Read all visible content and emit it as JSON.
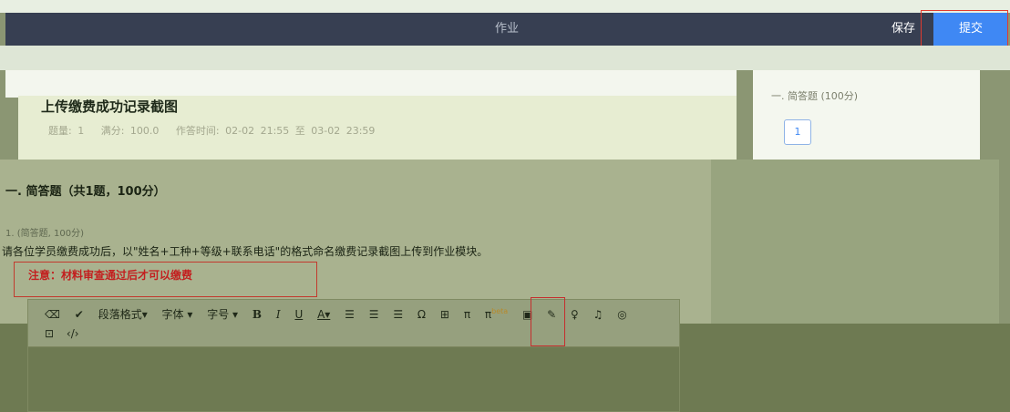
{
  "header": {
    "title": "作业",
    "save_label": "保存",
    "submit_label": "提交"
  },
  "homework": {
    "title": "上传缴费成功记录截图",
    "meta": {
      "count": "题量: 1",
      "full_score": "满分: 100.0",
      "time_label": "作答时间: 02-02 21:55 至 03-02 23:59"
    }
  },
  "sidebar": {
    "section_label": "一. 简答题 (100分)",
    "question_numbers": [
      "1"
    ]
  },
  "section": {
    "title": "一. 简答题（共1题，100分）"
  },
  "question": {
    "meta": "1. (简答题, 100分)",
    "text": "请各位学员缴费成功后，以\"姓名+工种+等级+联系电话\"的格式命名缴费记录截图上传到作业模块。",
    "note": "注意：材料审查通过后才可以缴费"
  },
  "editor": {
    "toolbar": {
      "paragraph_format": "段落格式▾",
      "font": "字体 ▾",
      "font_size": "字号 ▾",
      "bold": "B",
      "italic": "I",
      "underline": "U",
      "font_color": "A▾",
      "align_left": "☰",
      "align_center": "☰",
      "align_right": "☰",
      "omega": "Ω",
      "table": "⊞",
      "pi": "π",
      "pi_beta": "π",
      "beta": "beta",
      "image": "▣",
      "link": "✎",
      "mic": "♀",
      "music": "♫",
      "camera": "◎",
      "box": "⊡",
      "code": "‹/›"
    }
  },
  "colors": {
    "navbar": "#373f52",
    "submit": "#3f88f4",
    "highlight": "#e23b2e",
    "note": "#c31f1f"
  }
}
